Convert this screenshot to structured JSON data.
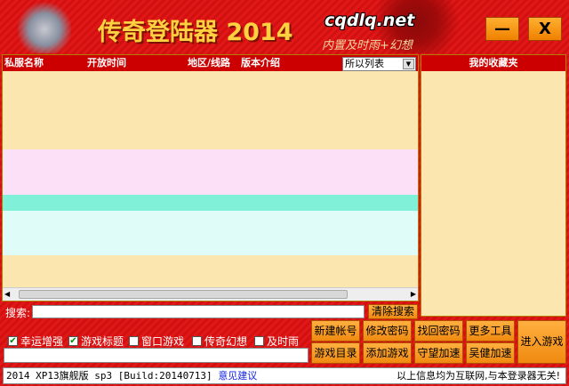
{
  "header": {
    "title": "传奇登陆器 2014",
    "site": "cqdlq.net",
    "subtitle": "内置及时雨+幻想",
    "minimize": "—",
    "close": "X"
  },
  "list": {
    "columns": [
      "私服名称",
      "开放时间",
      "地区/线路",
      "版本介绍"
    ],
    "filter": "所以列表",
    "rows_colors": [
      "#fce6b0",
      "#fbe0f8",
      "#80f0d8",
      "#e0fcf8",
      "#fce6b0"
    ]
  },
  "favorites": {
    "title": "我的收藏夹"
  },
  "search": {
    "label": "搜索:",
    "value": "",
    "clear": "清除搜索"
  },
  "options": [
    {
      "label": "幸运增强",
      "checked": true
    },
    {
      "label": "游戏标题",
      "checked": true
    },
    {
      "label": "窗口游戏",
      "checked": false
    },
    {
      "label": "传奇幻想",
      "checked": false
    },
    {
      "label": "及时雨",
      "checked": false
    }
  ],
  "buttons": [
    "新建帐号",
    "修改密码",
    "找回密码",
    "更多工具",
    "游戏目录",
    "添加游戏",
    "守望加速",
    "吴健加速"
  ],
  "enter": "进入游戏",
  "status": {
    "version": "2014  XP13旗舰版 sp3 [Build:20140713]",
    "feedback": "意见建议",
    "disclaimer": "以上信息均为互联网,与本登录器无关!"
  }
}
